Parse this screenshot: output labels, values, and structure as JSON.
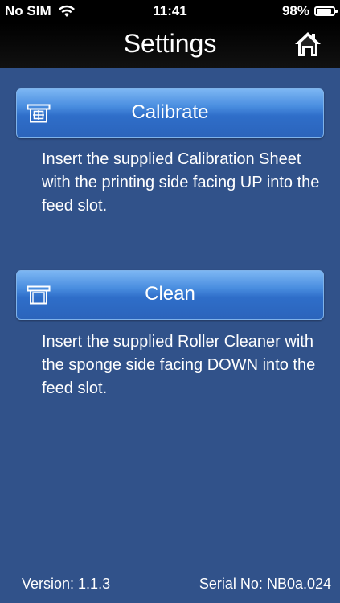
{
  "status_bar": {
    "carrier": "No SIM",
    "time": "11:41",
    "battery_percent": "98%",
    "battery_level": 0.98,
    "wifi_icon": "wifi-icon",
    "battery_icon": "battery-icon"
  },
  "nav": {
    "title": "Settings",
    "home_icon": "home-icon"
  },
  "calibrate": {
    "label": "Calibrate",
    "icon": "calibrate-icon",
    "instruction": "Insert the supplied Calibration Sheet with the printing side facing UP into the feed slot."
  },
  "clean": {
    "label": "Clean",
    "icon": "clean-icon",
    "instruction": "Insert the supplied Roller Cleaner with the sponge side facing DOWN into the feed slot."
  },
  "footer": {
    "version": "Version:  1.1.3",
    "serial": "Serial No: NB0a.024"
  },
  "colors": {
    "background": "#31528a",
    "button_top": "#7cb6f3",
    "button_bottom": "#2b64bb",
    "bar": "#000000"
  }
}
